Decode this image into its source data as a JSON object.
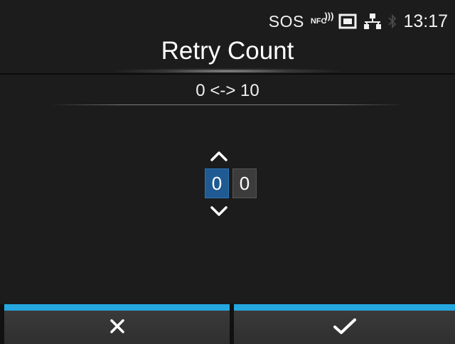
{
  "status_bar": {
    "sos_label": "SOS",
    "nfc_label": "NFC",
    "time": "13:17",
    "icons": [
      "nfc-icon",
      "sd-card-icon",
      "lan-icon",
      "bluetooth-icon"
    ]
  },
  "title": "Retry Count",
  "range_label": "0 <-> 10",
  "stepper": {
    "digits": [
      "0",
      "0"
    ],
    "selected_index": 0
  },
  "buttons": {
    "cancel_icon": "close-icon",
    "confirm_icon": "check-icon"
  },
  "colors": {
    "background": "#1c1c1c",
    "accent_blue": "#25a8e0",
    "selected_digit": "#1f5a92",
    "button_bg": "#353535"
  }
}
